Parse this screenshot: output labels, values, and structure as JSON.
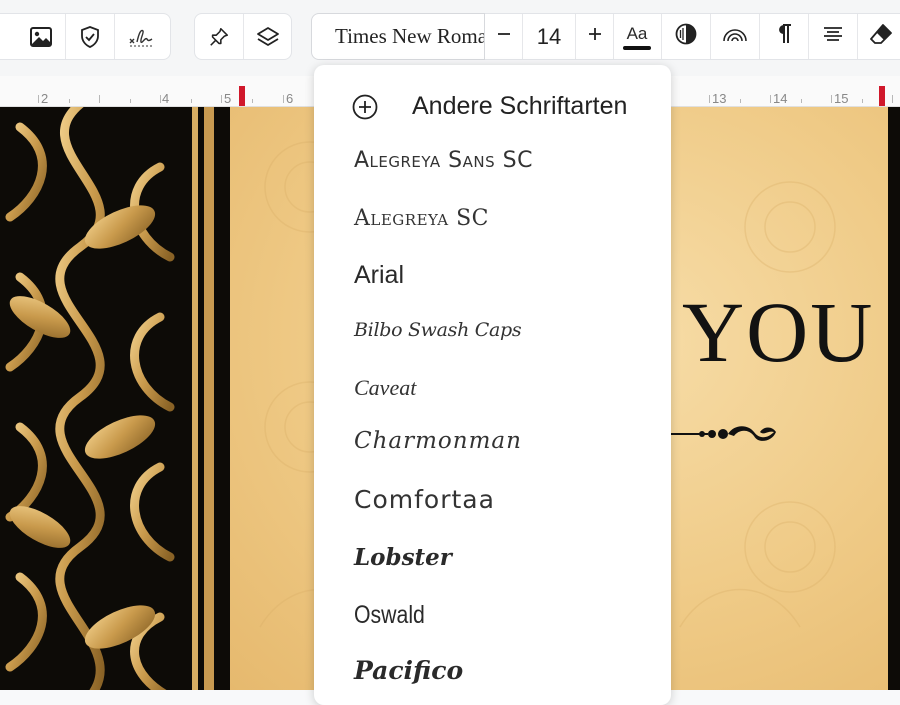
{
  "toolbar": {
    "left_group": [
      {
        "name": "image-icon"
      },
      {
        "name": "shield-icon"
      },
      {
        "name": "signature-icon"
      }
    ],
    "middle_group": [
      {
        "name": "pin-icon"
      },
      {
        "name": "layers-icon"
      }
    ],
    "font_name": "Times New Roman",
    "font_size": "14",
    "text_case_label": "Aa",
    "format_icons": [
      "contrast-icon",
      "rainbow-icon",
      "pilcrow-icon",
      "align-center-icon",
      "eraser-icon"
    ]
  },
  "ruler": {
    "numbers": [
      "2",
      "4",
      "5",
      "6",
      "13",
      "14",
      "15"
    ]
  },
  "document": {
    "heading_fragment": "YOU"
  },
  "font_menu": {
    "other_fonts_label": "Andere Schriftarten",
    "fonts": [
      "Alegreya Sans SC",
      "Alegreya SC",
      "Arial",
      "Bilbo Swash Caps",
      "Caveat",
      "Charmonman",
      "Comfortaa",
      "Lobster",
      "Oswald",
      "Pacifico"
    ]
  },
  "colors": {
    "accent_marker": "#d0182b",
    "page_gold": "#efca86",
    "page_dark": "#0d0b07"
  }
}
